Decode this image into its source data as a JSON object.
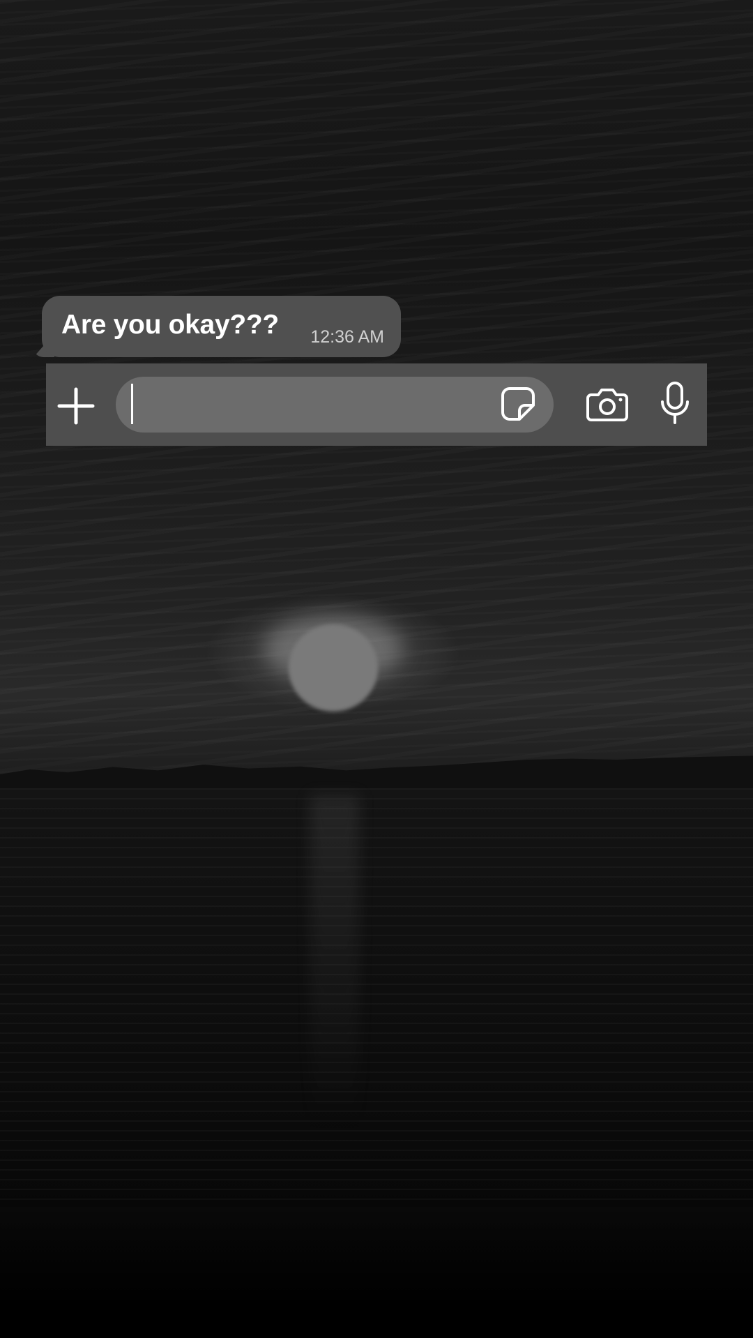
{
  "message": {
    "text": "Are you okay???",
    "time": "12:36 AM"
  },
  "composer": {
    "input_value": "",
    "attach_icon": "plus-icon",
    "sticker_icon": "sticker-icon",
    "camera_icon": "camera-icon",
    "mic_icon": "microphone-icon"
  },
  "colors": {
    "bubble": "#505050",
    "input_bar": "#4e4e4e",
    "text_field": "#6c6c6c",
    "icon": "#ffffff"
  }
}
